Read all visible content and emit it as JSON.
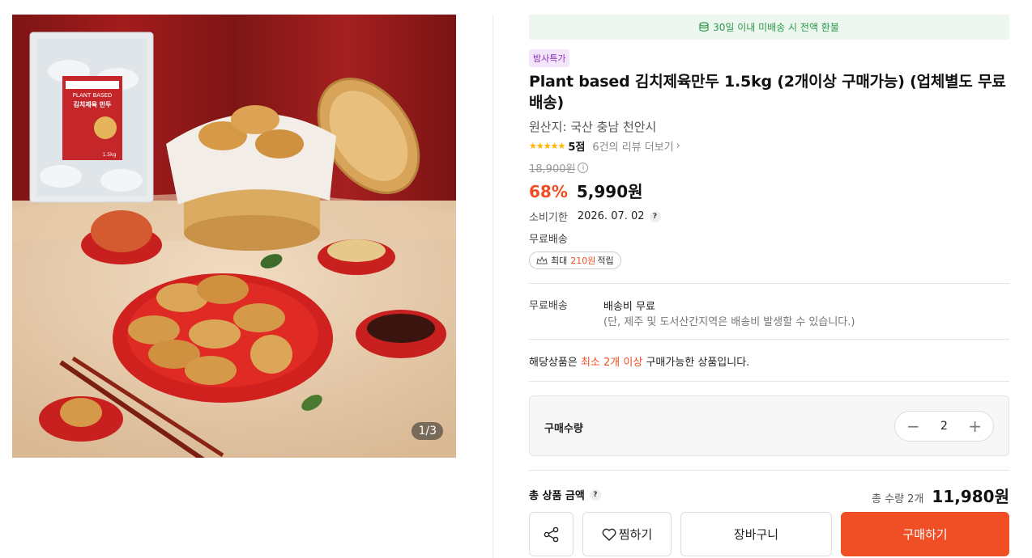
{
  "image": {
    "counter": "1/3",
    "package_labels": [
      "김치제육 만두",
      "PLANT BASED",
      "1.5kg"
    ]
  },
  "banner": {
    "icon": "coin-stack-icon",
    "text": "30일 이내 미배송 시 전액 환불"
  },
  "badge": "밤사특가",
  "title": "Plant based 김치제육만두 1.5kg (2개이상 구매가능) (업체별도 무료배송)",
  "origin": "원산지: 국산 충남 천안시",
  "rating": {
    "stars": "★★★★★",
    "score": "5점",
    "reviews": "6건의 리뷰 더보기"
  },
  "price": {
    "original": "18,900원",
    "discount": "68%",
    "current": "5,990원"
  },
  "expiry": {
    "label": "소비기한",
    "value": "2026. 07. 02"
  },
  "free_shipping": "무료배송",
  "points": {
    "prefix": "최대",
    "amount": "210원",
    "suffix": "적립"
  },
  "shipping": {
    "label": "무료배송",
    "main": "배송비 무료",
    "note": "(단, 제주 및 도서산간지역은 배송비 발생할 수 있습니다.)"
  },
  "min_purchase": {
    "prefix": "해당상품은",
    "highlight": "최소 2개 이상",
    "suffix": "구매가능한 상품입니다."
  },
  "quantity": {
    "label": "구매수량",
    "minus": "−",
    "value": "2",
    "plus": "+"
  },
  "total": {
    "label": "총 상품 금액",
    "count": "총 수량 2개",
    "price": "11,980원"
  },
  "buttons": {
    "wish": "찜하기",
    "cart": "장바구니",
    "buy": "구매하기"
  },
  "colors": {
    "accent": "#f04e25",
    "banner_text": "#2b9a4a",
    "badge_text": "#8f2fbf",
    "star": "#ffb400"
  }
}
